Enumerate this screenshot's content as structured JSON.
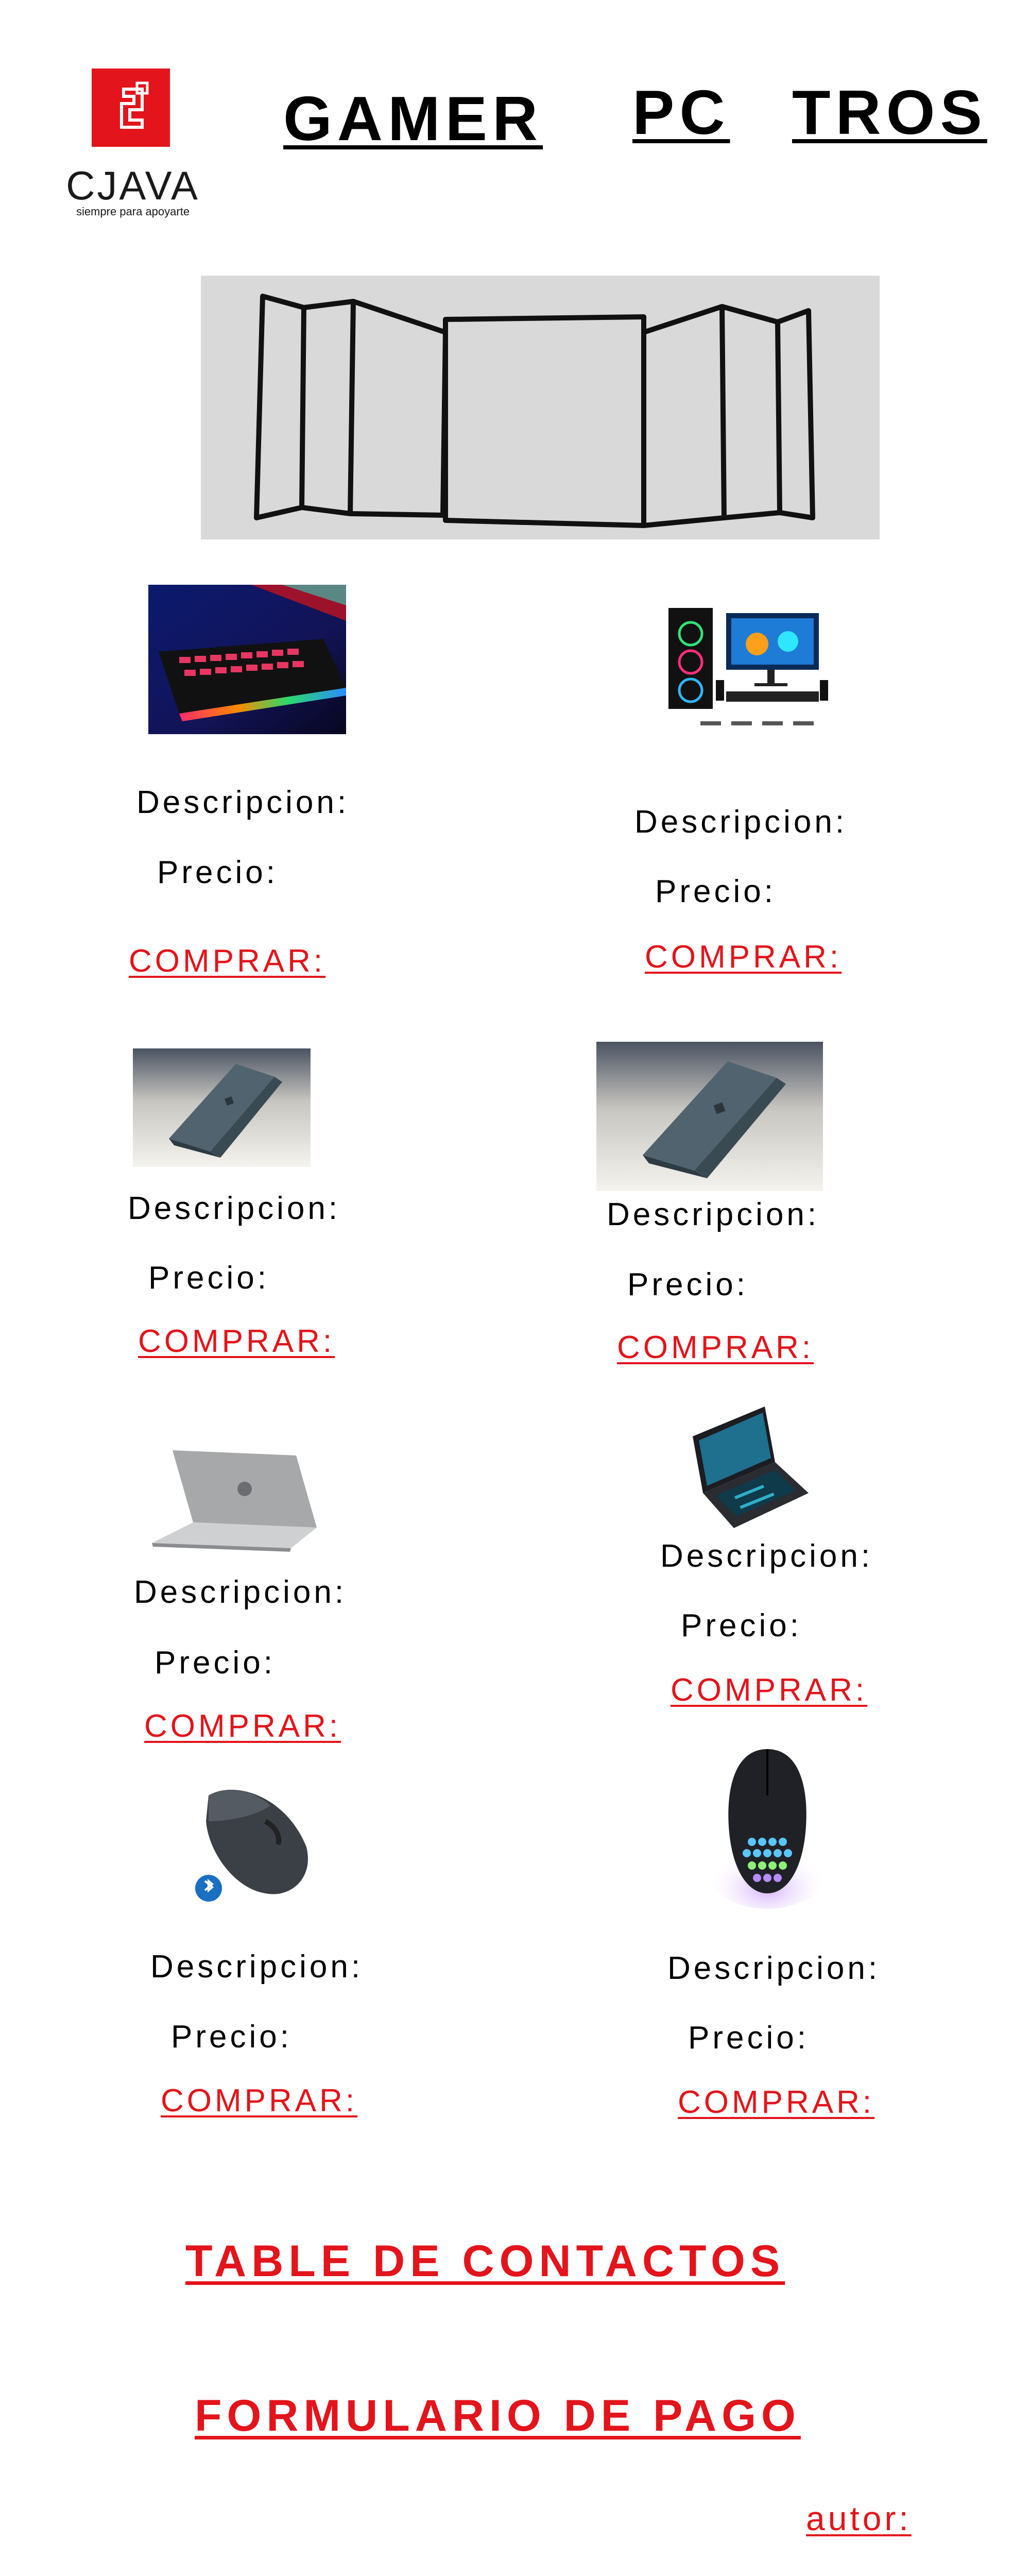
{
  "brand": {
    "name": "CJAVA",
    "tagline": "siempre para apoyarte",
    "color": "#e3141b"
  },
  "nav": {
    "items": [
      {
        "label": "GAMER"
      },
      {
        "label": "PC"
      },
      {
        "label": "TROS"
      }
    ]
  },
  "banner": {
    "icon": "carousel-frames-icon"
  },
  "products": [
    {
      "description_label": "Descripcion:",
      "price_label": "Precio:",
      "buy_label": "COMPRAR:",
      "image": "rgb-keyboard"
    },
    {
      "description_label": "Descripcion:",
      "price_label": "Precio:",
      "buy_label": "COMPRAR:",
      "image": "gaming-pc-bundle"
    },
    {
      "description_label": "Descripcion:",
      "price_label": "Precio:",
      "buy_label": "COMPRAR:",
      "image": "gray-laptop"
    },
    {
      "description_label": "Descripcion:",
      "price_label": "Precio:",
      "buy_label": "COMPRAR:",
      "image": "gray-laptop"
    },
    {
      "description_label": "Descripcion:",
      "price_label": "Precio:",
      "buy_label": "COMPRAR:",
      "image": "silver-laptop"
    },
    {
      "description_label": "Descripcion:",
      "price_label": "Precio:",
      "buy_label": "COMPRAR:",
      "image": "gaming-laptop"
    },
    {
      "description_label": "Descripcion:",
      "price_label": "Precio:",
      "buy_label": "COMPRAR:",
      "image": "bluetooth-mouse"
    },
    {
      "description_label": "Descripcion:",
      "price_label": "Precio:",
      "buy_label": "COMPRAR:",
      "image": "rgb-gaming-mouse"
    }
  ],
  "footer": {
    "contacts_label": "TABLE DE CONTACTOS",
    "payment_label": "FORMULARIO DE PAGO",
    "author_label": "autor:"
  }
}
